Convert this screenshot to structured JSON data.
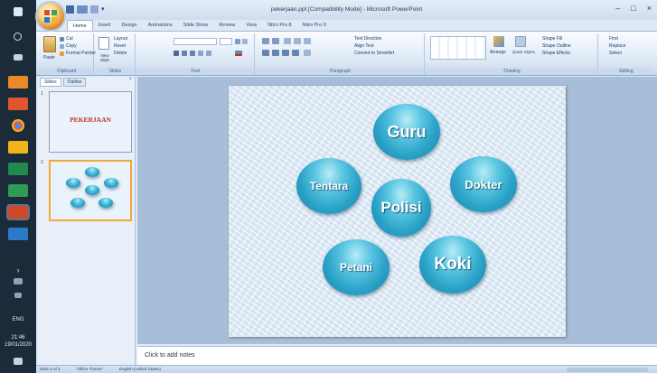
{
  "window": {
    "title": "pekerjaan.ppt [Compatibility Mode] - Microsoft PowerPoint"
  },
  "window_controls": {
    "minimize": "–",
    "maximize": "□",
    "close": "×"
  },
  "tabs": [
    {
      "label": "Home",
      "active": true
    },
    {
      "label": "Insert",
      "active": false
    },
    {
      "label": "Design",
      "active": false
    },
    {
      "label": "Animations",
      "active": false
    },
    {
      "label": "Slide Show",
      "active": false
    },
    {
      "label": "Review",
      "active": false
    },
    {
      "label": "View",
      "active": false
    },
    {
      "label": "Nitro Pro 8",
      "active": false
    },
    {
      "label": "Nitro Pro 9",
      "active": false
    }
  ],
  "ribbon": {
    "clipboard": {
      "label": "Clipboard",
      "paste": "Paste",
      "cut": "Cut",
      "copy": "Copy",
      "format_painter": "Format Painter"
    },
    "slides": {
      "label": "Slides",
      "new_slide": "New Slide",
      "layout": "Layout",
      "reset": "Reset",
      "delete": "Delete"
    },
    "font": {
      "label": "Font"
    },
    "paragraph": {
      "label": "Paragraph",
      "text_direction": "Text Direction",
      "align_text": "Align Text",
      "convert_smartart": "Convert to SmartArt"
    },
    "drawing": {
      "label": "Drawing",
      "arrange": "Arrange",
      "quick_styles": "Quick Styles",
      "shape_fill": "Shape Fill",
      "shape_outline": "Shape Outline",
      "shape_effects": "Shape Effects"
    },
    "editing": {
      "label": "Editing",
      "find": "Find",
      "replace": "Replace",
      "select": "Select"
    }
  },
  "panel": {
    "tabs": [
      {
        "label": "Slides",
        "active": true
      },
      {
        "label": "Outline",
        "active": false
      }
    ],
    "close": "×",
    "thumbnails": [
      {
        "number": "1",
        "title": "PEKERJAAN",
        "selected": false
      },
      {
        "number": "2",
        "title": "",
        "selected": true
      }
    ]
  },
  "slide": {
    "bubbles": [
      {
        "label": "Guru"
      },
      {
        "label": "Tentara"
      },
      {
        "label": "Polisi"
      },
      {
        "label": "Dokter"
      },
      {
        "label": "Petani"
      },
      {
        "label": "Koki"
      }
    ]
  },
  "notes": {
    "placeholder": "Click to add notes"
  },
  "status": {
    "slide": "Slide 2 of 2",
    "theme": "\"Office Theme\"",
    "language": "English (United States)"
  },
  "taskbar": {
    "lang": "ENG",
    "time": "21:46",
    "date": "19/01/2020"
  },
  "colors": {
    "accent": "#2ba3c8",
    "title_red": "#c2322b",
    "taskbar": "#1b2b3a"
  }
}
